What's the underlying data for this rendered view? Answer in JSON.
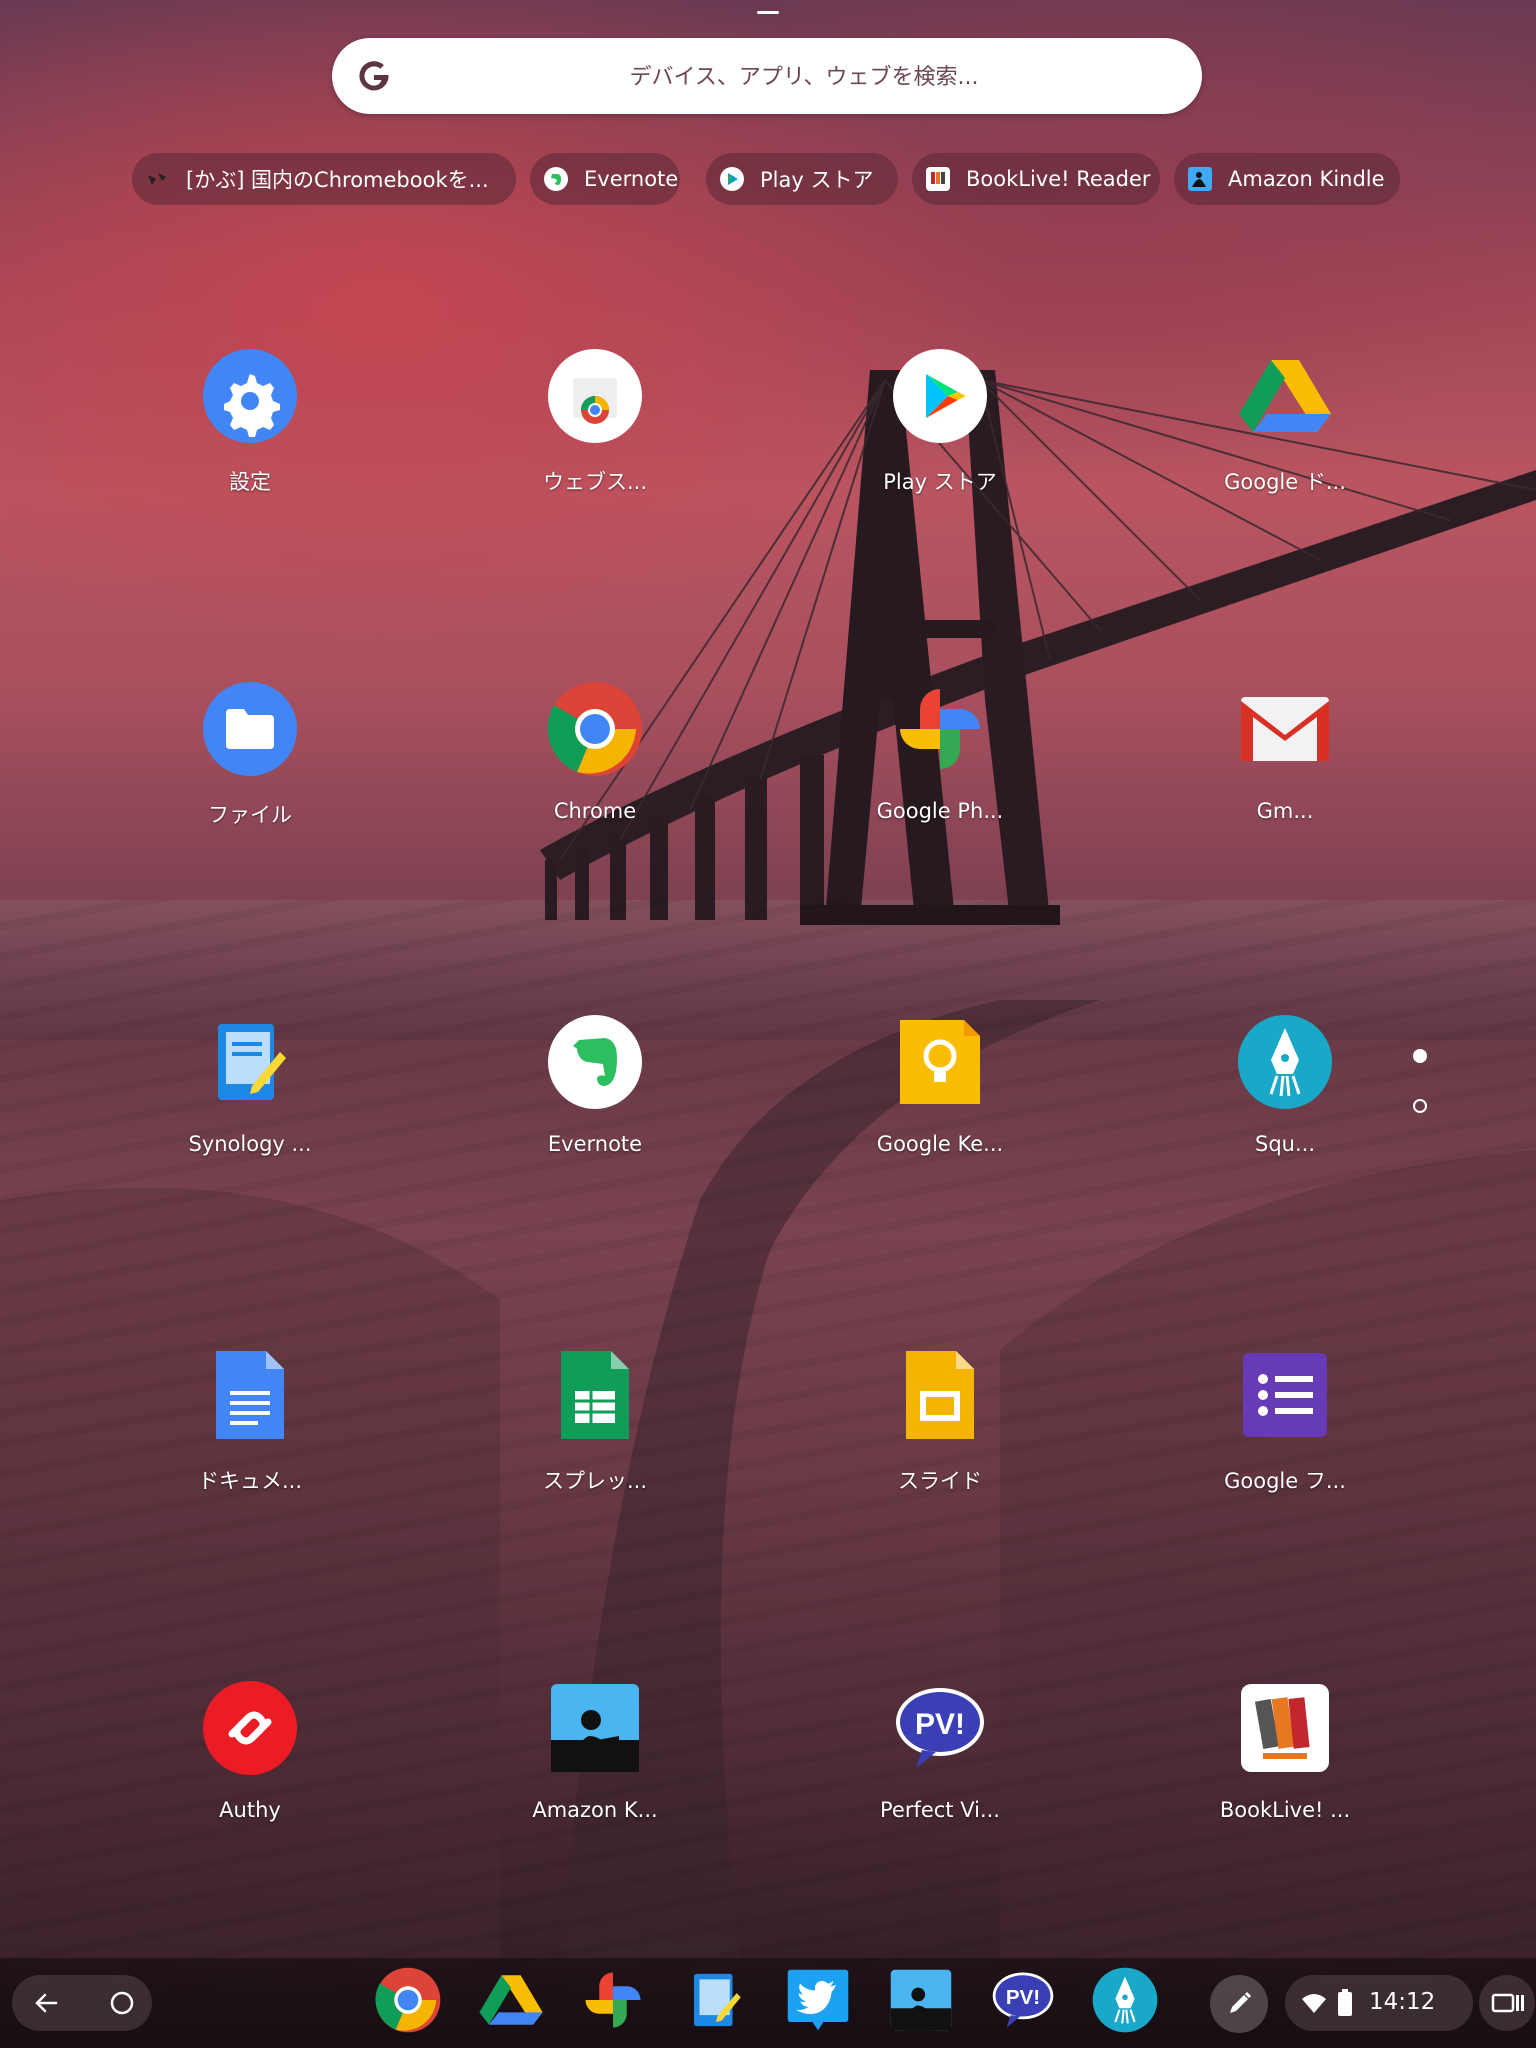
{
  "search": {
    "placeholder": "デバイス、アプリ、ウェブを検索..."
  },
  "suggestions": [
    {
      "label": "[かぶ] 国内のChromebookを...",
      "icon": "web-page-icon"
    },
    {
      "label": "Evernote",
      "icon": "evernote-icon"
    },
    {
      "label": "Play ストア",
      "icon": "play-store-icon"
    },
    {
      "label": "BookLive! Reader",
      "icon": "booklive-icon"
    },
    {
      "label": "Amazon Kindle",
      "icon": "kindle-icon"
    }
  ],
  "apps": [
    {
      "label": "設定",
      "icon": "settings-icon"
    },
    {
      "label": "ウェブス...",
      "icon": "web-store-icon"
    },
    {
      "label": "Play ストア",
      "icon": "play-store-icon"
    },
    {
      "label": "Google ド...",
      "icon": "google-drive-icon"
    },
    {
      "label": "ファイル",
      "icon": "files-icon"
    },
    {
      "label": "Chrome",
      "icon": "chrome-icon"
    },
    {
      "label": "Google Ph...",
      "icon": "google-photos-icon"
    },
    {
      "label": "Gm...",
      "icon": "gmail-icon"
    },
    {
      "label": "Synology ...",
      "icon": "synology-note-icon"
    },
    {
      "label": "Evernote",
      "icon": "evernote-icon"
    },
    {
      "label": "Google Ke...",
      "icon": "google-keep-icon"
    },
    {
      "label": "Squ...",
      "icon": "squid-icon"
    },
    {
      "label": "ドキュメ...",
      "icon": "google-docs-icon"
    },
    {
      "label": "スプレッ...",
      "icon": "google-sheets-icon"
    },
    {
      "label": "スライド",
      "icon": "google-slides-icon"
    },
    {
      "label": "Google フ...",
      "icon": "google-forms-icon"
    },
    {
      "label": "Authy",
      "icon": "authy-icon"
    },
    {
      "label": "Amazon K...",
      "icon": "kindle-icon"
    },
    {
      "label": "Perfect Vi...",
      "icon": "perfect-viewer-icon"
    },
    {
      "label": "BookLive! ...",
      "icon": "booklive-icon"
    }
  ],
  "page_indicator": {
    "current": 1,
    "total": 2
  },
  "shelf": {
    "pinned_apps": [
      "chrome-icon",
      "google-drive-icon",
      "google-photos-icon",
      "synology-note-icon",
      "twitter-icon",
      "kindle-icon",
      "perfect-viewer-icon",
      "squid-icon"
    ],
    "time": "14:12"
  },
  "colors": {
    "accent_blue": "#4285f4",
    "search_text": "#6b4854"
  }
}
